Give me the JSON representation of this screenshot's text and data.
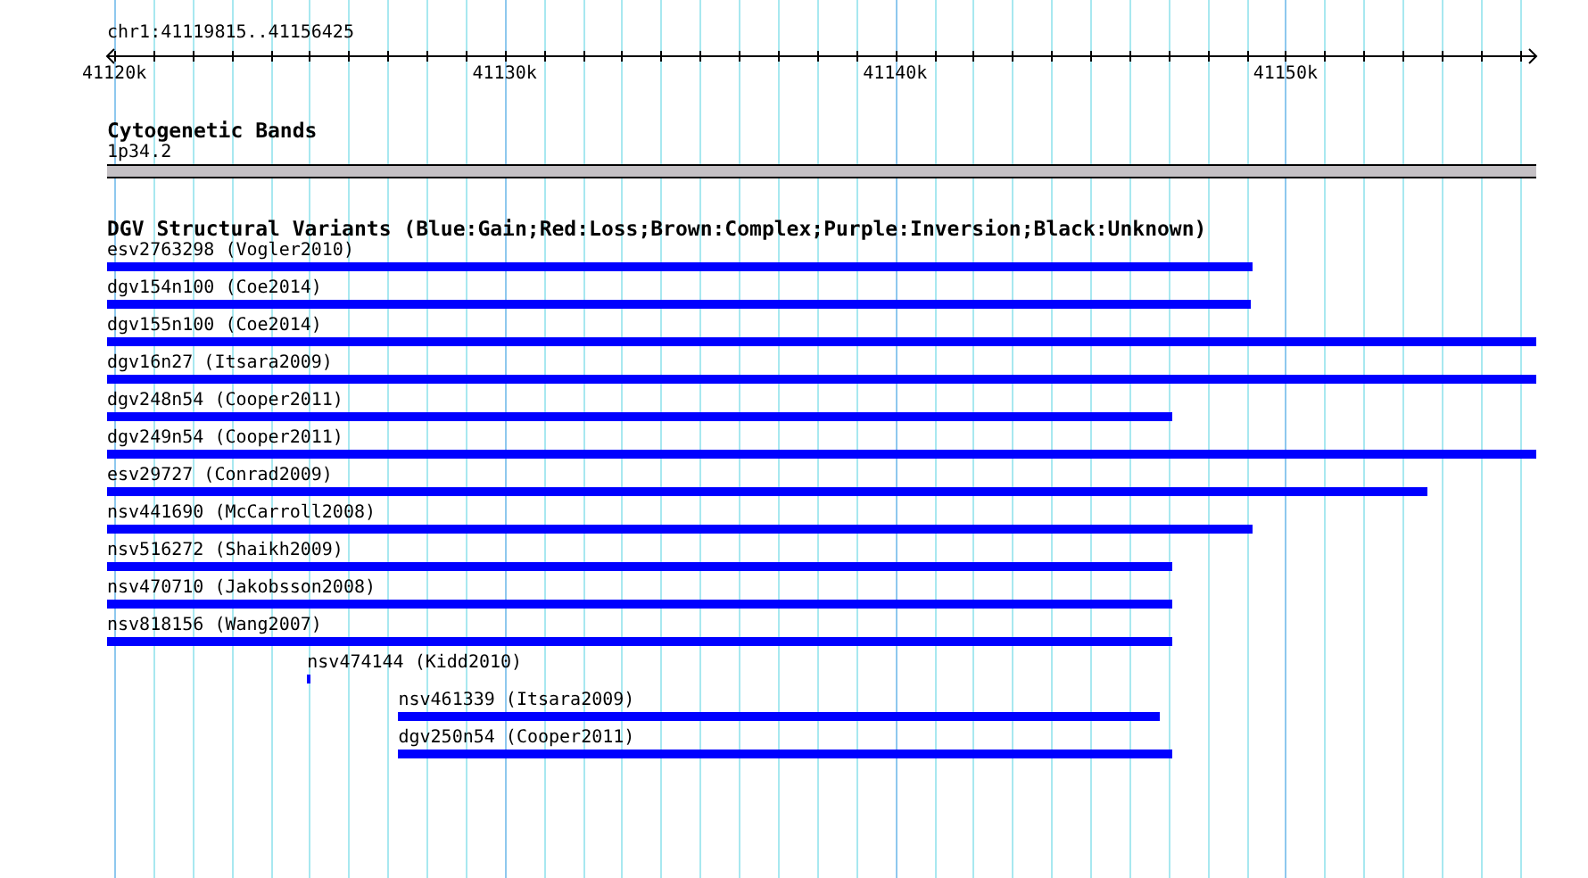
{
  "ruler": {
    "region": "chr1:41119815..41156425",
    "major_ticks": [
      {
        "label": "41120k"
      },
      {
        "label": "41130k"
      },
      {
        "label": "41140k"
      },
      {
        "label": "41150k"
      }
    ]
  },
  "cytogenetic_track": {
    "title": "Cytogenetic Bands",
    "band": {
      "name": "1p34.2"
    }
  },
  "variant_track": {
    "title": "DGV Structural Variants (Blue:Gain;Red:Loss;Brown:Complex;Purple:Inversion;Black:Unknown)",
    "features": [
      {
        "label": "esv2763298 (Vogler2010)",
        "color": "#0000ff"
      },
      {
        "label": "dgv154n100 (Coe2014)",
        "color": "#0000ff"
      },
      {
        "label": "dgv155n100 (Coe2014)",
        "color": "#0000ff"
      },
      {
        "label": "dgv16n27 (Itsara2009)",
        "color": "#0000ff"
      },
      {
        "label": "dgv248n54 (Cooper2011)",
        "color": "#0000ff"
      },
      {
        "label": "dgv249n54 (Cooper2011)",
        "color": "#0000ff"
      },
      {
        "label": "esv29727 (Conrad2009)",
        "color": "#0000ff"
      },
      {
        "label": "nsv441690 (McCarroll2008)",
        "color": "#0000ff"
      },
      {
        "label": "nsv516272 (Shaikh2009)",
        "color": "#0000ff"
      },
      {
        "label": "nsv470710 (Jakobsson2008)",
        "color": "#0000ff"
      },
      {
        "label": "nsv818156 (Wang2007)",
        "color": "#0000ff"
      },
      {
        "label": "nsv474144 (Kidd2010)",
        "color": "#0000ff"
      },
      {
        "label": "nsv461339 (Itsara2009)",
        "color": "#0000ff"
      },
      {
        "label": "dgv250n54 (Cooper2011)",
        "color": "#0000ff"
      }
    ]
  }
}
